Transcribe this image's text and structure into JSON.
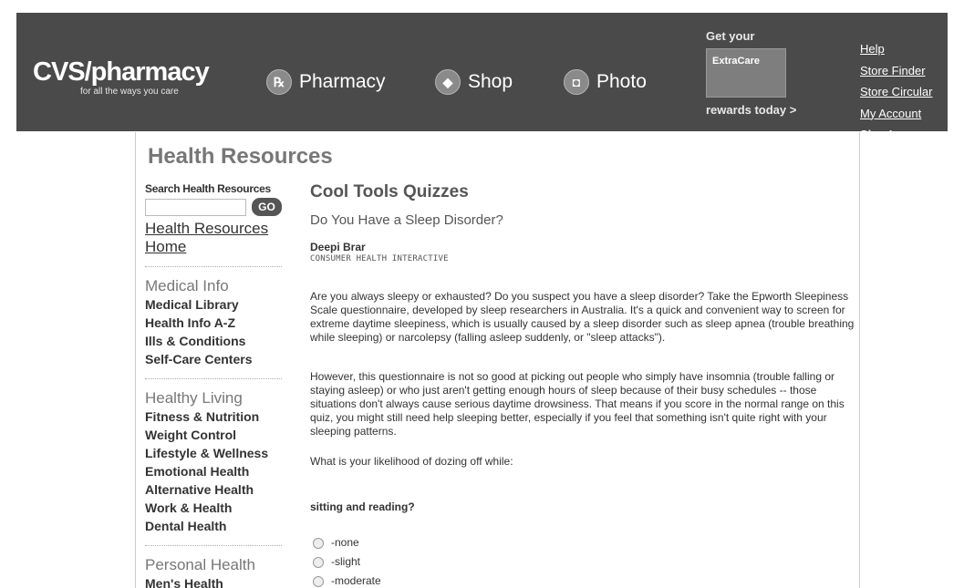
{
  "header": {
    "logo_main": "CVS/pharmacy",
    "logo_tag": "for all the ways you care",
    "nav": [
      {
        "label": "Pharmacy",
        "icon": "rx-icon"
      },
      {
        "label": "Shop",
        "icon": "tag-icon"
      },
      {
        "label": "Photo",
        "icon": "camera-icon"
      }
    ],
    "extracare": {
      "top": "Get your",
      "card_title": "ExtraCare",
      "bottom": "rewards today >"
    },
    "links": [
      "Help",
      "Store Finder",
      "Store Circular",
      "My Account",
      "Sign In"
    ]
  },
  "page_title": "Health Resources",
  "sidebar": {
    "search_label": "Search Health Resources",
    "go_label": "GO",
    "home_link": "Health Resources Home",
    "sections": [
      {
        "title": "Medical Info",
        "links": [
          "Medical Library",
          "Health Info A-Z",
          "Ills & Conditions",
          "Self-Care Centers"
        ]
      },
      {
        "title": "Healthy Living",
        "links": [
          "Fitness & Nutrition",
          "Weight Control",
          "Lifestyle & Wellness",
          "Emotional Health",
          "Alternative Health",
          "Work & Health",
          "Dental Health"
        ]
      },
      {
        "title": "Personal Health",
        "links": [
          "Men's Health"
        ]
      }
    ]
  },
  "article": {
    "section": "Cool Tools Quizzes",
    "title": "Do You Have a Sleep Disorder?",
    "author": "Deepi Brar",
    "org": "CONSUMER HEALTH INTERACTIVE",
    "p1": "Are you always sleepy or exhausted? Do you suspect you have a sleep disorder? Take the Epworth Sleepiness Scale questionnaire, developed by sleep researchers in Australia. It's a quick and convenient way to screen for extreme daytime sleepiness, which is usually caused by a sleep disorder such as sleep apnea (trouble breathing while sleeping) or narcolepsy (falling asleep suddenly, or \"sleep attacks\").",
    "p2": "However, this questionnaire is not so good at picking out people who simply have insomnia (trouble falling or staying asleep) or who just aren't getting enough hours of sleep because of their busy schedules -- those situations don't always cause serious daytime drowsiness. That means if you score in the normal range on this quiz, you might still need help sleeping better, especially if you feel that something isn't quite right with your sleeping patterns.",
    "p3": "What is your likelihood of dozing off while:",
    "question": "sitting and reading?",
    "options": [
      "-none",
      "-slight",
      "-moderate"
    ]
  }
}
